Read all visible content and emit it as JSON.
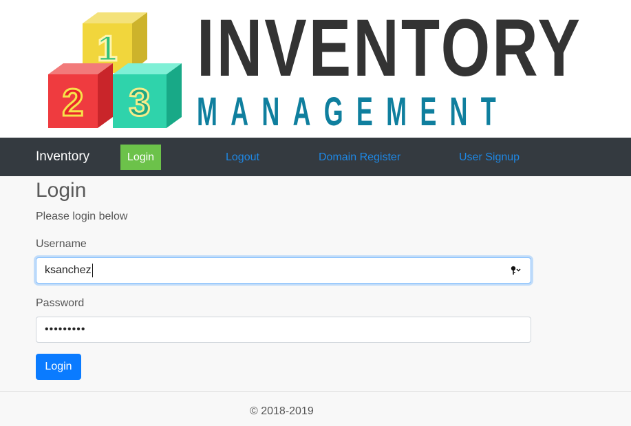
{
  "logo": {
    "line1": "INVENTORY",
    "line2": "MANAGEMENT",
    "blocks": [
      "1",
      "2",
      "3"
    ]
  },
  "navbar": {
    "brand": "Inventory",
    "items": [
      {
        "label": "Login",
        "active": true
      },
      {
        "label": "Logout"
      },
      {
        "label": "Domain Register"
      },
      {
        "label": "User Signup"
      }
    ]
  },
  "form": {
    "title": "Login",
    "subtitle": "Please login below",
    "username_label": "Username",
    "username_value": "ksanchez",
    "password_label": "Password",
    "password_value": "•••••••••",
    "submit_label": "Login"
  },
  "footer": {
    "copyright": "© 2018-2019"
  },
  "colors": {
    "navbar": "#343a40",
    "active_nav": "#6cc24a",
    "link": "#1e88e5",
    "primary": "#0a7bff",
    "logo_dark": "#333333",
    "logo_teal": "#0f7f9e"
  },
  "icons": {
    "password_manager": "key-icon"
  }
}
